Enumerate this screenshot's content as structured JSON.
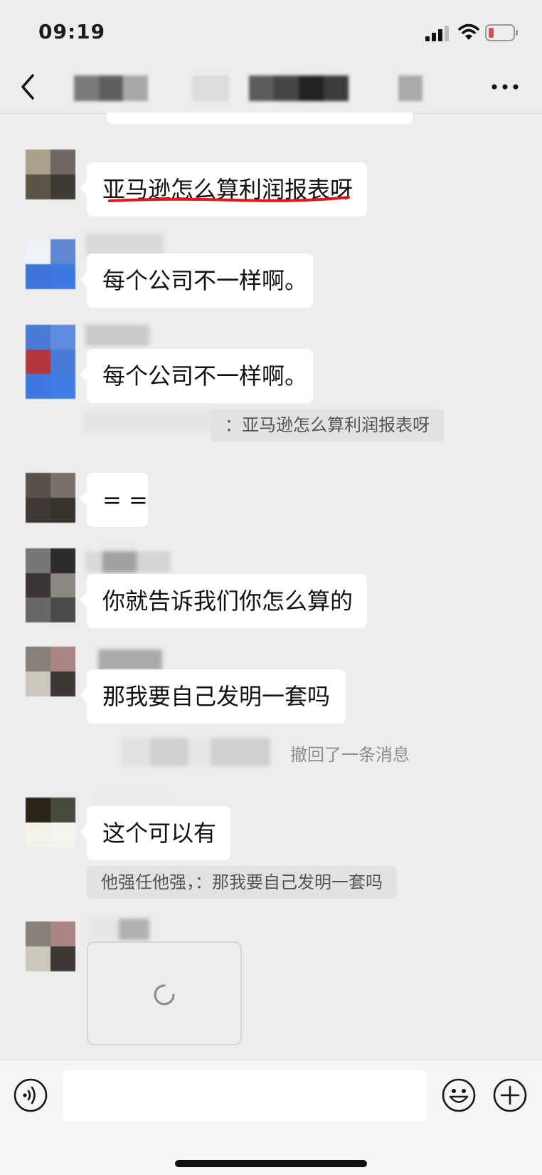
{
  "status_bar": {
    "time": "09:19",
    "icons": [
      "signal-icon",
      "wifi-icon",
      "battery-low-icon"
    ],
    "battery_color": "#e5484d"
  },
  "nav": {
    "back_icon": "chevron-left-icon",
    "more_icon": "more-dots-icon"
  },
  "messages": [
    {
      "type": "text",
      "text": "亚马逊怎么算利润报表呀",
      "underline_color": "#e0181b"
    },
    {
      "type": "text",
      "text": "每个公司不一样啊。"
    },
    {
      "type": "text",
      "text": "每个公司不一样啊。",
      "quote": "：亚马逊怎么算利润报表呀"
    },
    {
      "type": "text",
      "text": "= ="
    },
    {
      "type": "text",
      "text": "你就告诉我们你怎么算的"
    },
    {
      "type": "text",
      "text": "那我要自己发明一套吗"
    },
    {
      "type": "system",
      "text": "撤回了一条消息"
    },
    {
      "type": "text",
      "text": "这个可以有",
      "quote": "他强任他强，：那我要自己发明一套吗"
    },
    {
      "type": "image",
      "state": "loading",
      "icon": "loading-spinner-icon"
    }
  ],
  "input_bar": {
    "placeholder": "",
    "icons": [
      "voice-icon",
      "emoji-icon",
      "plus-icon"
    ]
  },
  "colors": {
    "background": "#ededed",
    "bubble": "#ffffff",
    "quote_background": "#e2e2e2",
    "system_text": "#8d8d8d"
  }
}
